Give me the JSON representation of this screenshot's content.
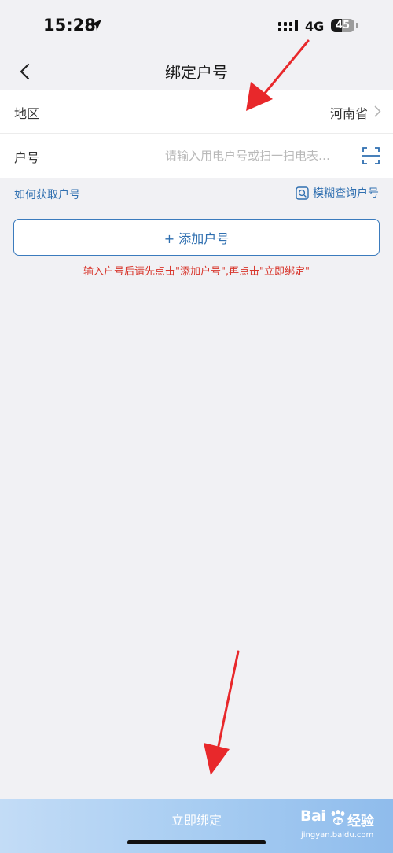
{
  "status_bar": {
    "time": "15:28",
    "network": "4G",
    "battery": "45",
    "battery_level": 0.45
  },
  "nav": {
    "title": "绑定户号"
  },
  "form": {
    "region_label": "地区",
    "region_value": "河南省",
    "account_label": "户号",
    "account_placeholder": "请输入用电户号或扫一扫电表…",
    "account_value": ""
  },
  "links": {
    "how_to_get": "如何获取户号",
    "fuzzy_search": "模糊查询户号"
  },
  "add_button": {
    "label": "+ 添加户号"
  },
  "hint": {
    "text": "输入户号后请先点击\"添加户号\",再点击\"立即绑定\""
  },
  "bottom": {
    "bind_label": "立即绑定"
  },
  "watermark": {
    "brand_left": "Bai",
    "brand_right": "经验",
    "url": "jingyan.baidu.com"
  },
  "colors": {
    "accent": "#2f6fb0",
    "hint": "#d8362c",
    "annotation_arrow": "#e8282b"
  },
  "icons": [
    "location-arrow-icon",
    "signal-icon",
    "battery-icon",
    "back-icon",
    "chevron-right-icon",
    "scan-icon",
    "search-icon",
    "paw-icon"
  ]
}
